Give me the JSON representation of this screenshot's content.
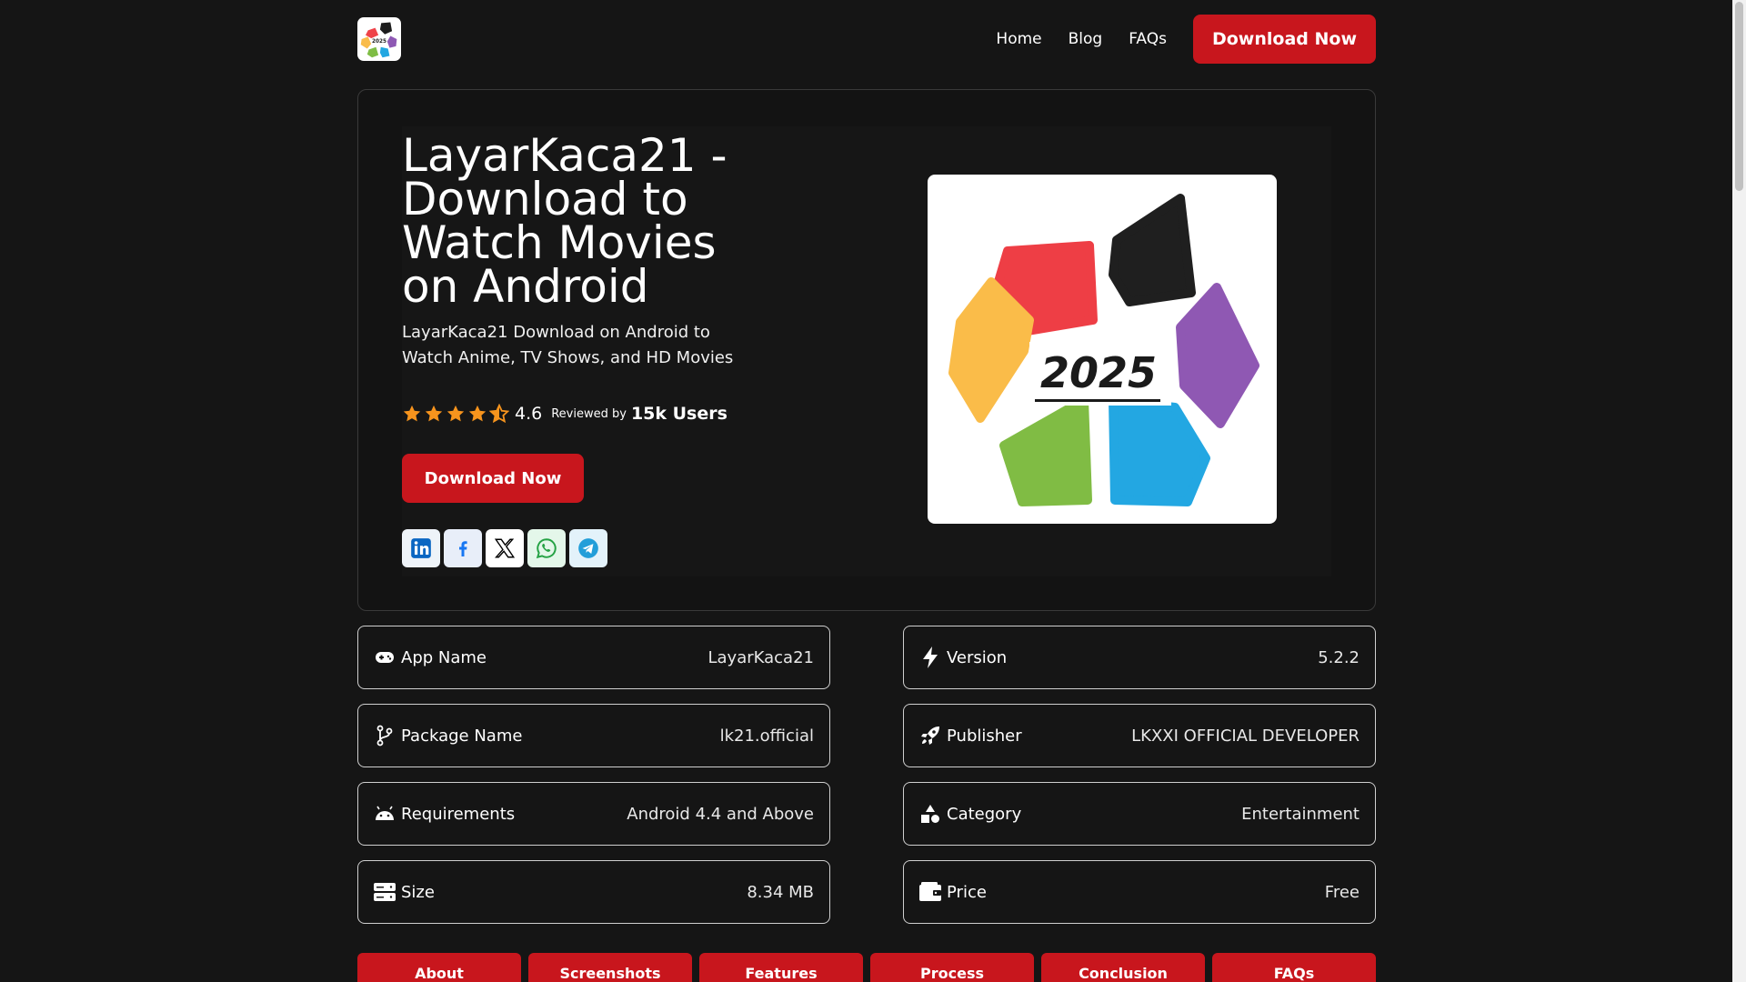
{
  "header": {
    "logo_text": "2025",
    "nav": [
      "Home",
      "Blog",
      "FAQs"
    ],
    "download_label": "Download Now"
  },
  "hero": {
    "title": "LayarKaca21 - Download to Watch Movies on Android",
    "subtitle": "LayarKaca21 Download on Android to Watch Anime, TV Shows, and HD Movies",
    "rating": {
      "stars": 4.5,
      "score": "4.6",
      "reviewed_by": "Reviewed by",
      "users": "15k Users"
    },
    "download_label": "Download Now",
    "image_text": "2025",
    "share": [
      "linkedin-icon",
      "facebook-icon",
      "x-icon",
      "whatsapp-icon",
      "telegram-icon"
    ]
  },
  "info": {
    "left": [
      {
        "icon": "gamepad-icon",
        "label": "App Name",
        "value": "LayarKaca21"
      },
      {
        "icon": "git-branch-icon",
        "label": "Package Name",
        "value": "lk21.official"
      },
      {
        "icon": "android-icon",
        "label": "Requirements",
        "value": "Android 4.4 and Above"
      },
      {
        "icon": "server-icon",
        "label": "Size",
        "value": "8.34 MB"
      }
    ],
    "right": [
      {
        "icon": "lightning-icon",
        "label": "Version",
        "value": "5.2.2"
      },
      {
        "icon": "rocket-icon",
        "label": "Publisher",
        "value": "LKXXI OFFICIAL DEVELOPER"
      },
      {
        "icon": "shapes-icon",
        "label": "Category",
        "value": "Entertainment"
      },
      {
        "icon": "wallet-icon",
        "label": "Price",
        "value": "Free"
      }
    ]
  },
  "tabs": [
    "About",
    "Screenshots",
    "Features",
    "Process",
    "Conclusion",
    "FAQs"
  ],
  "colors": {
    "background": "#151515",
    "accent": "#c8161d",
    "star": "#f7941d"
  }
}
